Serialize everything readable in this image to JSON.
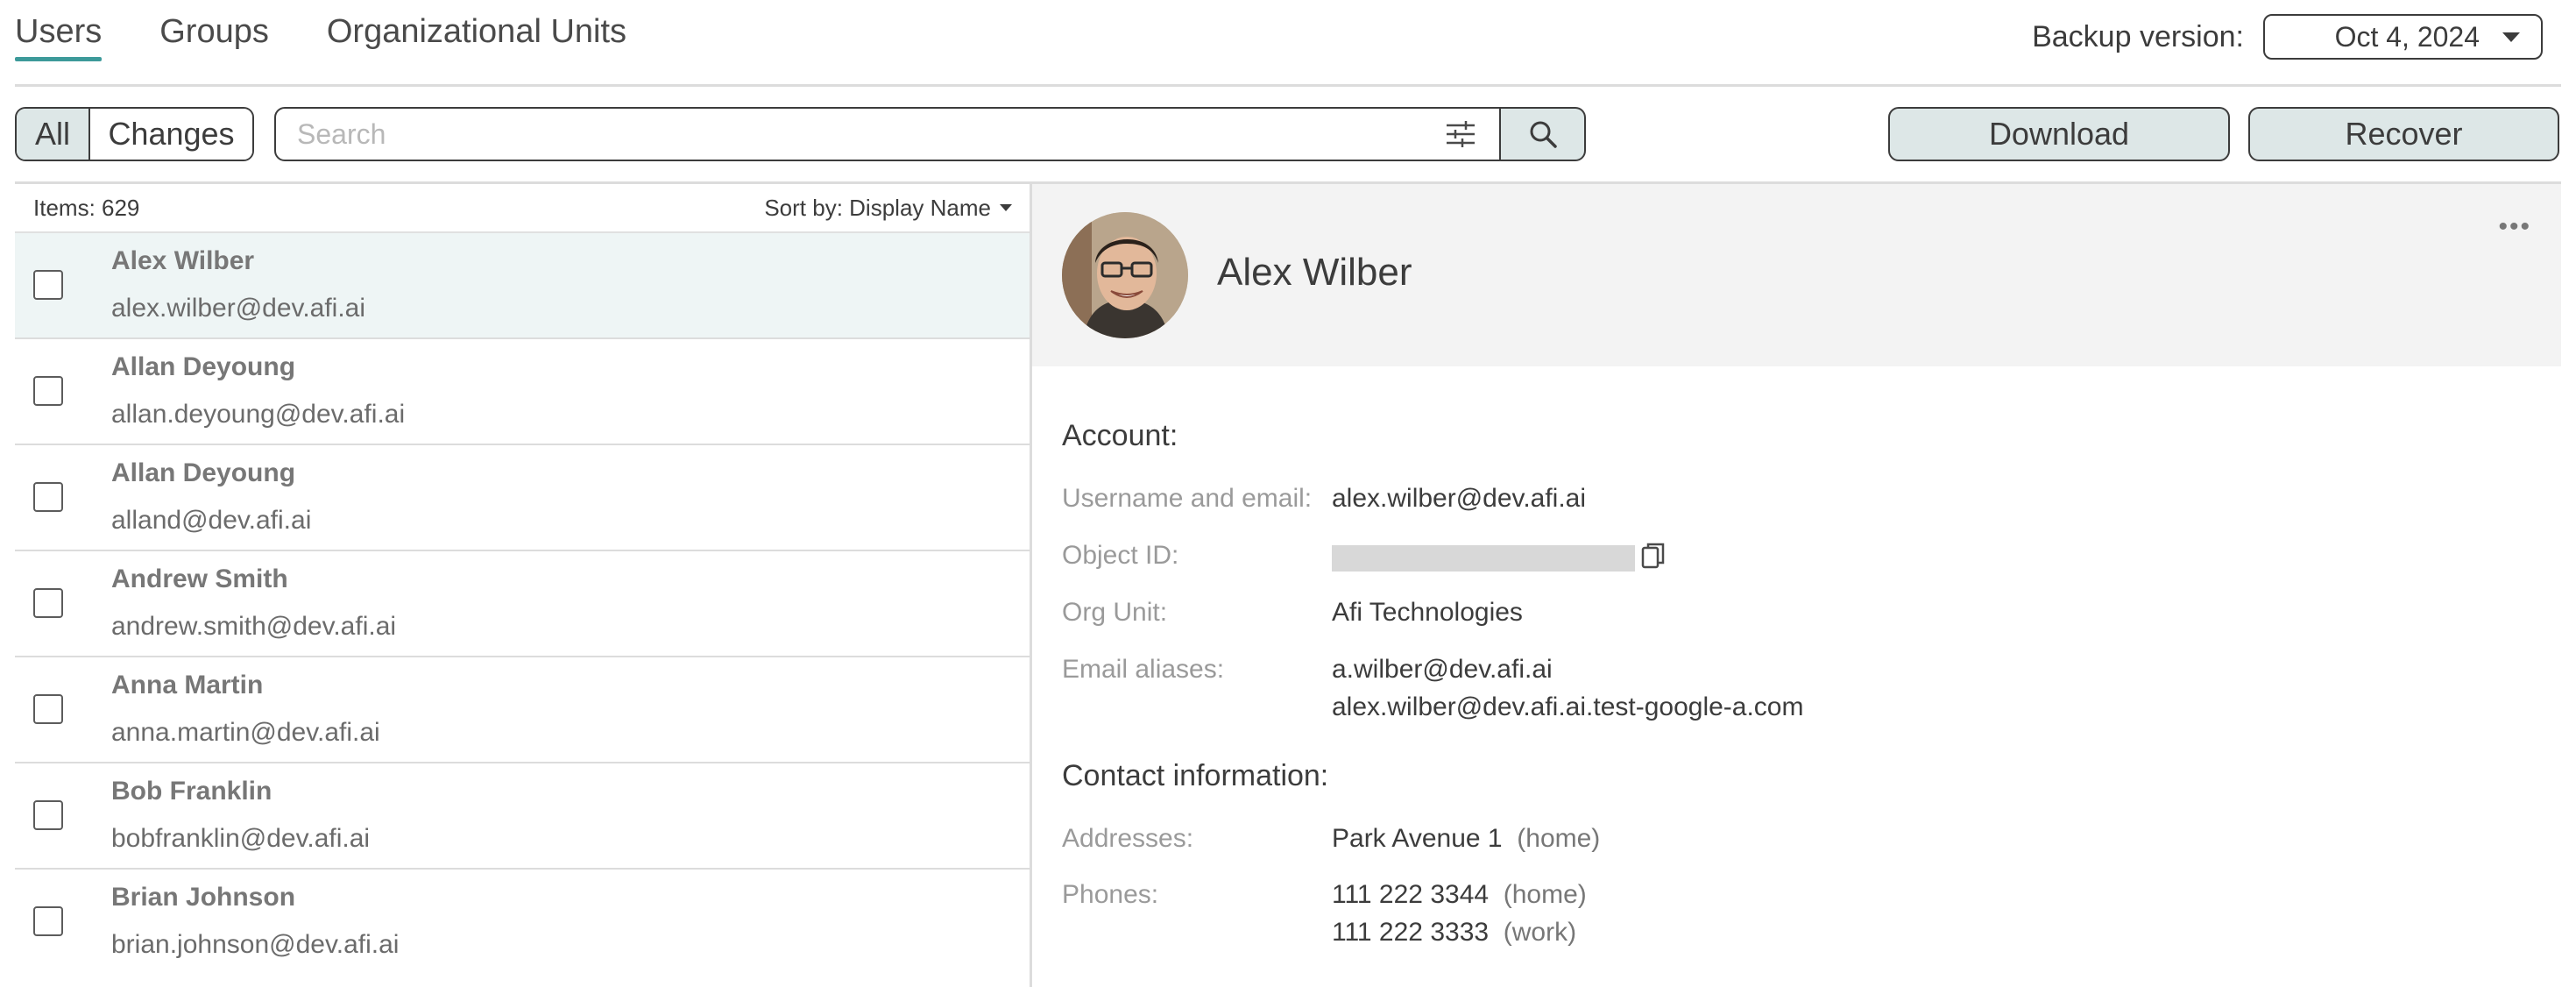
{
  "tabs": [
    {
      "label": "Users",
      "active": true
    },
    {
      "label": "Groups",
      "active": false
    },
    {
      "label": "Organizational Units",
      "active": false
    }
  ],
  "backup": {
    "label": "Backup version:",
    "value": "Oct 4, 2024"
  },
  "toolbar": {
    "all_label": "All",
    "changes_label": "Changes",
    "search_placeholder": "Search",
    "search_value": "",
    "download_label": "Download",
    "recover_label": "Recover"
  },
  "list": {
    "items_count": "Items: 629",
    "sort_label": "Sort by: Display Name",
    "rows": [
      {
        "name": "Alex Wilber",
        "email": "alex.wilber@dev.afi.ai",
        "selected": true,
        "checked": false
      },
      {
        "name": "Allan Deyoung",
        "email": "allan.deyoung@dev.afi.ai",
        "selected": false,
        "checked": false
      },
      {
        "name": "Allan Deyoung",
        "email": "alland@dev.afi.ai",
        "selected": false,
        "checked": false
      },
      {
        "name": "Andrew Smith",
        "email": "andrew.smith@dev.afi.ai",
        "selected": false,
        "checked": false
      },
      {
        "name": "Anna Martin",
        "email": "anna.martin@dev.afi.ai",
        "selected": false,
        "checked": false
      },
      {
        "name": "Bob Franklin",
        "email": "bobfranklin@dev.afi.ai",
        "selected": false,
        "checked": false
      },
      {
        "name": "Brian Johnson",
        "email": "brian.johnson@dev.afi.ai",
        "selected": false,
        "checked": false
      }
    ]
  },
  "detail": {
    "name": "Alex Wilber",
    "more_icon": "more-horizontal-icon",
    "account_title": "Account:",
    "username_label": "Username and email:",
    "username_value": "alex.wilber@dev.afi.ai",
    "object_id_label": "Object ID:",
    "org_unit_label": "Org Unit:",
    "org_unit_value": "Afi Technologies",
    "aliases_label": "Email aliases:",
    "aliases": [
      "a.wilber@dev.afi.ai",
      "alex.wilber@dev.afi.ai.test-google-a.com"
    ],
    "contact_title": "Contact information:",
    "addresses_label": "Addresses:",
    "address_value": "Park Avenue 1",
    "address_type": "(home)",
    "phones_label": "Phones:",
    "phones": [
      {
        "number": "111 222 3344",
        "type": "(home)"
      },
      {
        "number": "111 222 3333",
        "type": "(work)"
      }
    ]
  },
  "colors": {
    "accent": "#3d9a9a",
    "button_bg": "#dde7e7",
    "selected_row": "#eef5f5"
  }
}
